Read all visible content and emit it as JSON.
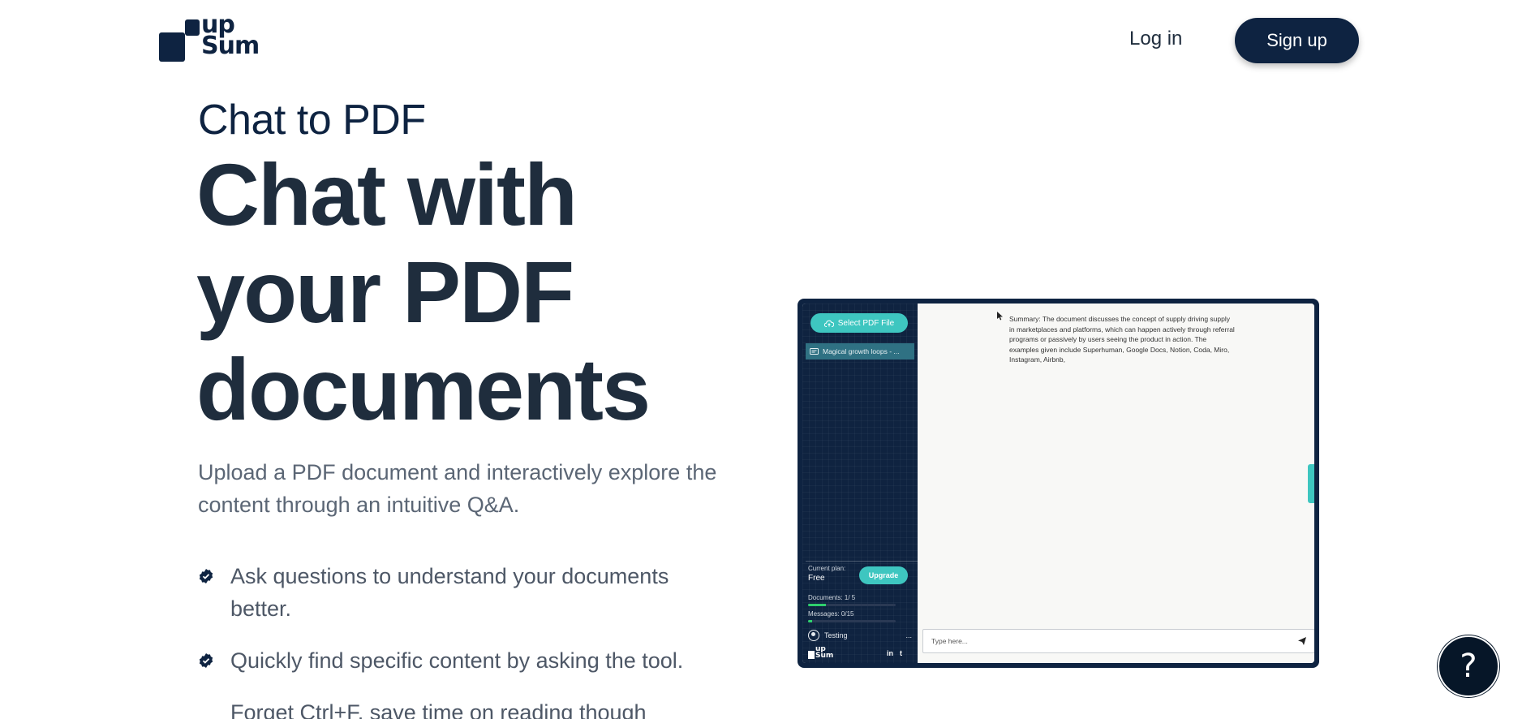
{
  "header": {
    "logo_text": "up Sum",
    "login_label": "Log in",
    "signup_label": "Sign up"
  },
  "hero": {
    "eyebrow": "Chat to PDF",
    "headline": "Chat with your PDF documents",
    "subtitle": "Upload a PDF document and interactively explore the content through an intuitive Q&A.",
    "features": [
      "Ask questions to understand your documents better.",
      "Quickly find specific content by asking the tool.",
      "Forget Ctrl+F, save time on reading though"
    ]
  },
  "app_preview": {
    "select_button": "Select PDF File",
    "document_item": "Magical growth loops - ...",
    "plan_label": "Current plan:",
    "plan_value": "Free",
    "upgrade_label": "Upgrade",
    "documents_usage": "Documents: 1/ 5",
    "documents_fraction": 0.2,
    "messages_usage": "Messages: 0/15",
    "messages_fraction": 0.05,
    "user_name": "Testing",
    "user_more": "...",
    "mini_logo": "up Sum",
    "social": [
      "in",
      "t"
    ],
    "summary": "Summary: The document discusses the concept of supply driving supply in marketplaces and platforms, which can happen actively through referral programs or passively by users seeing the product in action. The examples given include Superhuman, Google Docs, Notion, Coda, Miro, Instagram, Airbnb,",
    "input_placeholder": "Type here..."
  },
  "help_label": "?",
  "colors": {
    "brand_navy": "#0e2341",
    "accent_teal": "#3ec6c0",
    "progress_green": "#2fcf6e"
  }
}
